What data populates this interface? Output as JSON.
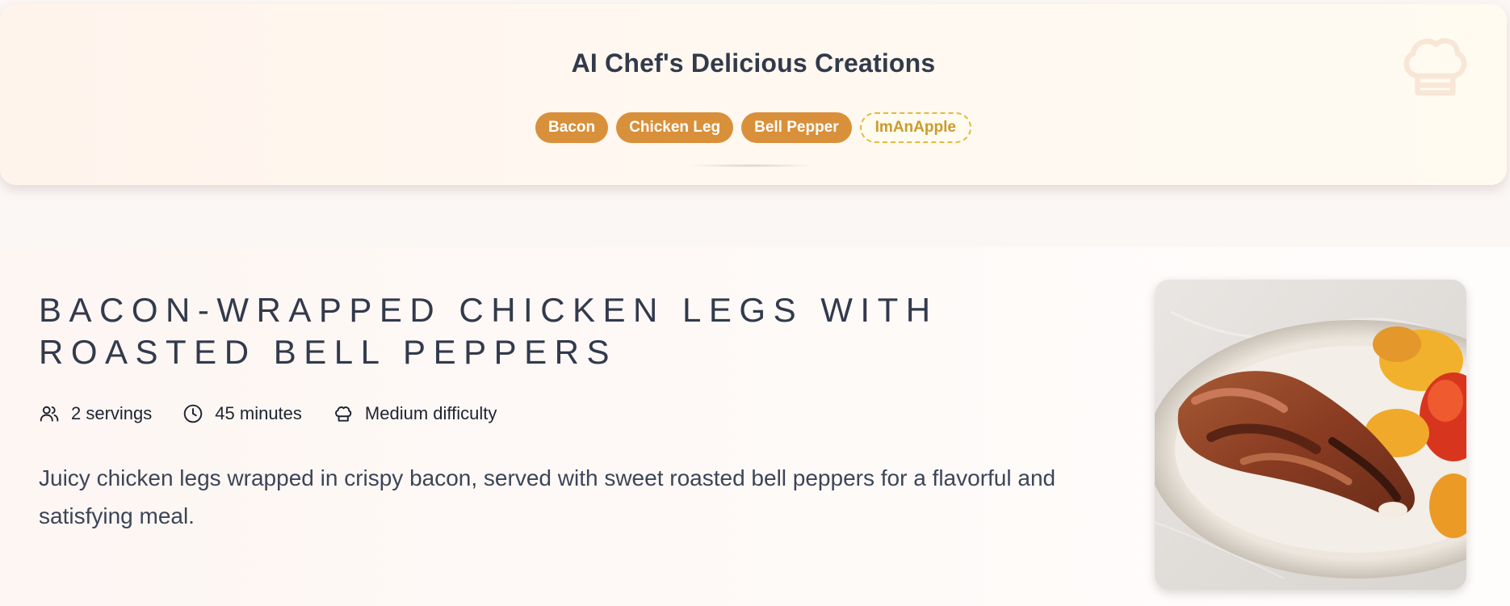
{
  "header": {
    "title": "AI Chef's Delicious Creations",
    "tags": [
      {
        "label": "Bacon",
        "style": "solid"
      },
      {
        "label": "Chicken Leg",
        "style": "solid"
      },
      {
        "label": "Bell Pepper",
        "style": "solid"
      },
      {
        "label": "ImAnApple",
        "style": "dashed"
      }
    ],
    "icon": "chef-hat-icon"
  },
  "recipe": {
    "title": "Bacon-Wrapped Chicken Legs with Roasted Bell Peppers",
    "servings": "2 servings",
    "time": "45 minutes",
    "difficulty": "Medium difficulty",
    "description": "Juicy chicken legs wrapped in crispy bacon, served with sweet roasted bell peppers for a flavorful and satisfying meal.",
    "icons": {
      "servings": "users-icon",
      "time": "clock-icon",
      "difficulty": "chef-hat-icon"
    }
  },
  "colors": {
    "tag_solid": "#d9903a",
    "tag_dashed_border": "#e3b93f",
    "title_text": "#323a4c"
  }
}
